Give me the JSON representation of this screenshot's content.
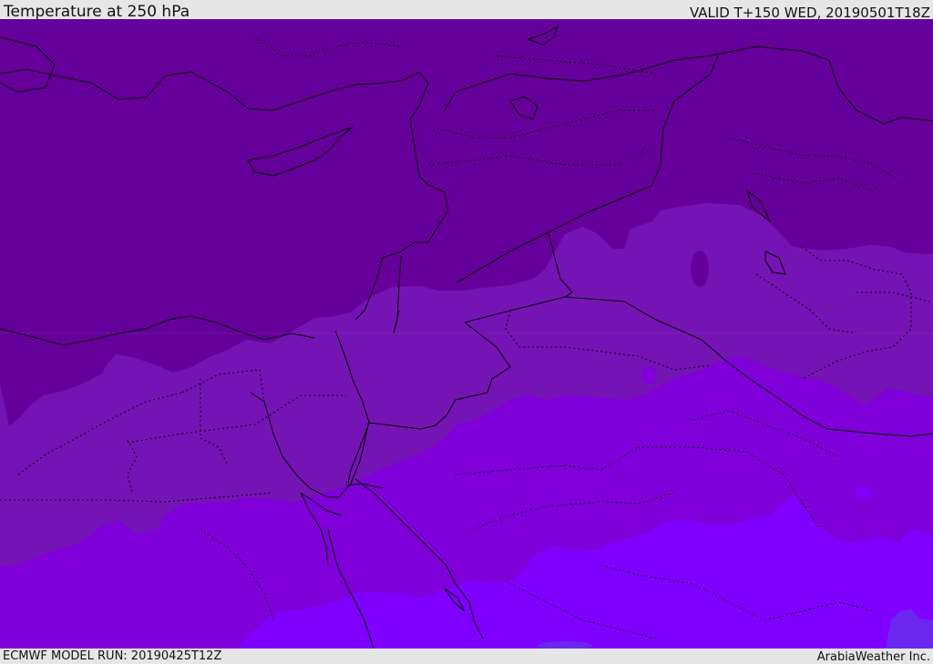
{
  "header": {
    "title": "Temperature at 250 hPa",
    "valid": "VALID T+150 WED, 20190501T18Z"
  },
  "footer": {
    "model_run": "ECMWF MODEL RUN: 20190425T12Z",
    "credit": "ArabiaWeather Inc."
  },
  "colors": {
    "band_coldest": "#66009a",
    "band_cold": "#7514b4",
    "band_mid": "#7f00d8",
    "band_warm": "#8000ff",
    "band_warmest": "#6a28ee",
    "coastline": "#000000",
    "border": "#000000",
    "chrome": "#e6e6e6"
  }
}
